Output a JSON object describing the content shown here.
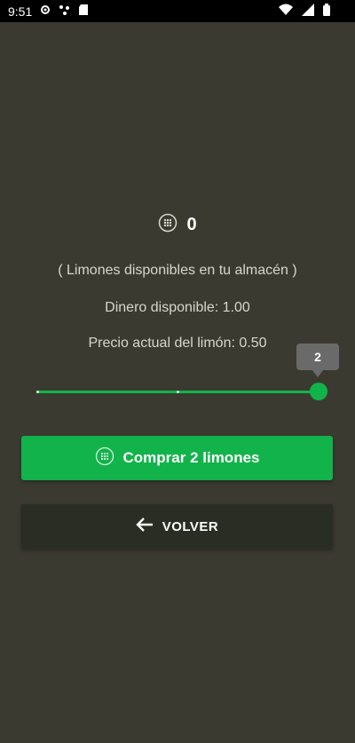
{
  "status_bar": {
    "time": "9:51"
  },
  "inventory": {
    "lemon_count": "0",
    "caption": "( Limones disponibles en tu almacén )"
  },
  "money": {
    "available_text": "Dinero disponible: 1.00"
  },
  "price": {
    "current_text": "Precio actual del limón: 0.50"
  },
  "slider": {
    "value": "2",
    "fill_fraction": 1.0
  },
  "buy_button": {
    "label": "Comprar 2 limones"
  },
  "back_button": {
    "label": "VOLVER"
  },
  "colors": {
    "accent": "#12b34a",
    "background": "#3b3a30",
    "back_button": "#2a2d24"
  },
  "icons": {
    "lemon": "lemon-icon",
    "back": "arrow-left-icon"
  }
}
